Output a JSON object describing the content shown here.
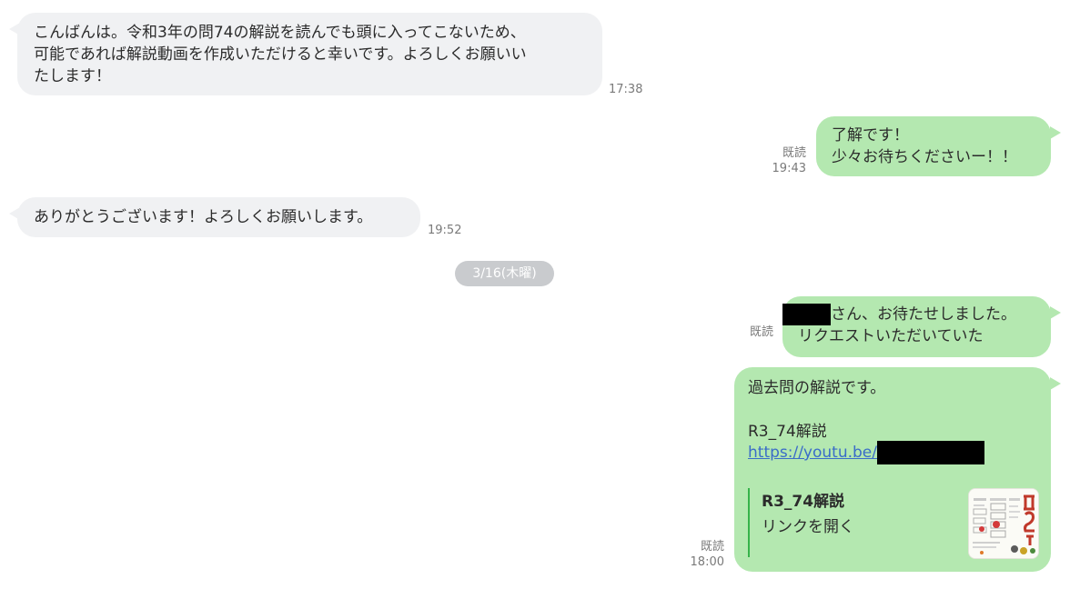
{
  "messages": [
    {
      "side": "incoming",
      "lines": [
        "こんばんは。令和3年の問74の解説を読んでも頭に入ってこないため、",
        "可能であれば解説動画を作成いただけると幸いです。よろしくお願いい",
        "たします！"
      ],
      "time": "17:38"
    },
    {
      "side": "outgoing",
      "lines": [
        "了解です！",
        "少々お待ちくださいー！！"
      ],
      "read": "既読",
      "time": "19:43"
    },
    {
      "side": "incoming",
      "lines": [
        "ありがとうございます！よろしくお願いします。"
      ],
      "time": "19:52"
    },
    {
      "side": "outgoing",
      "lines": [
        "さん、お待たせしました。",
        "リクエストいただいていた"
      ],
      "read": "既読"
    },
    {
      "side": "outgoing",
      "lines": [
        "過去問の解説です。",
        "R3_74解説"
      ],
      "link_text": "https://youtu.be/",
      "card": {
        "title": "R3_74解説",
        "action": "リンクを開く"
      },
      "read": "既読",
      "time": "18:00"
    }
  ],
  "date_separator": "3/16(木曜)",
  "colors": {
    "incoming_bubble": "#f0f1f3",
    "outgoing_bubble": "#b4e8b0",
    "link": "#3a6cc8",
    "card_accent": "#36b34a",
    "date_pill": "#c9cbce"
  }
}
